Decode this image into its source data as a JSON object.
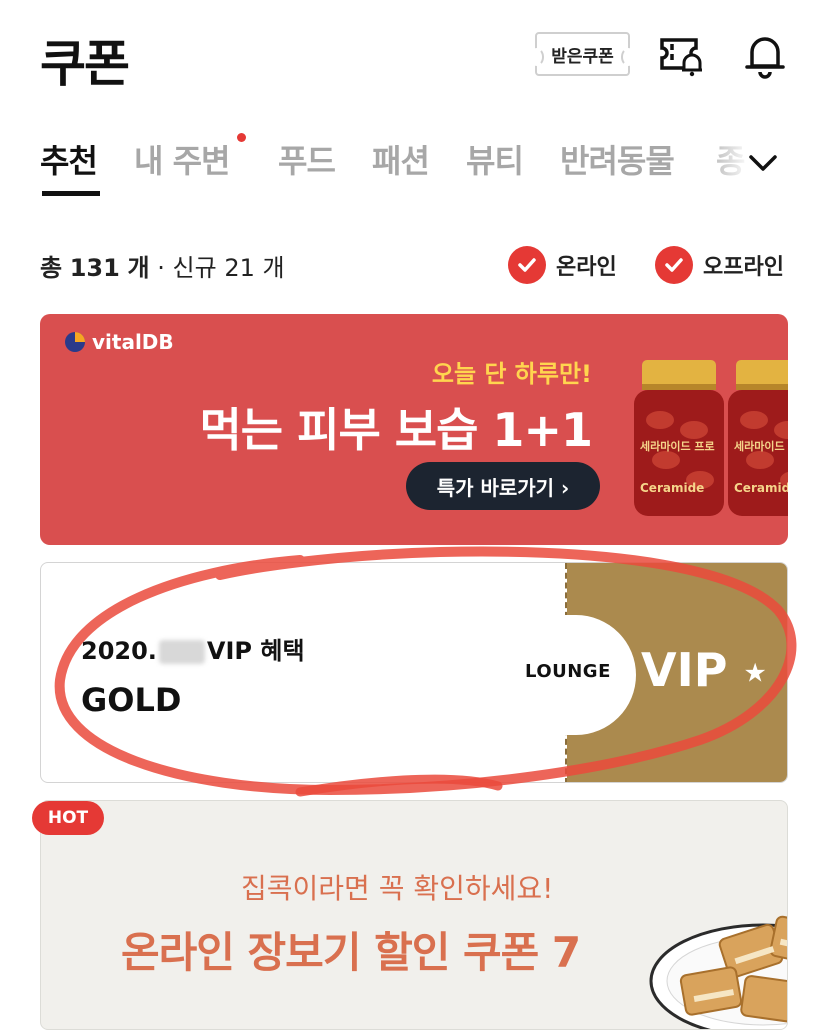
{
  "header": {
    "title": "쿠폰",
    "received_button": "받은쿠폰",
    "icons": [
      "ticket-bell-icon",
      "bell-icon"
    ]
  },
  "tabs": [
    {
      "label": "추천",
      "active": true
    },
    {
      "label": "내 주변",
      "has_dot": true
    },
    {
      "label": "푸드"
    },
    {
      "label": "패션"
    },
    {
      "label": "뷰티"
    },
    {
      "label": "반려동물"
    },
    {
      "label": "종"
    }
  ],
  "summary": {
    "total_prefix": "총",
    "total_count": "131",
    "total_unit": "개",
    "separator": "·",
    "new_prefix": "신규",
    "new_count": "21",
    "new_unit": "개"
  },
  "filters": [
    {
      "label": "온라인",
      "checked": true
    },
    {
      "label": "오프라인",
      "checked": true
    }
  ],
  "banner_promo": {
    "brand": "vitalDB",
    "headline_small": "오늘 단 하루만!",
    "headline_big": "먹는 피부 보습 1+1",
    "button": "특가 바로가기 ›",
    "product_label": "세라마이드 프로",
    "product_sub": "Ceramide",
    "color": "#d94f4f"
  },
  "vip_coupon": {
    "date_prefix": "2020.",
    "date_suffix": "VIP 혜택",
    "tier": "GOLD",
    "lounge": "LOUNGE",
    "badge": "VIP",
    "star": "★",
    "gold_color": "#ab8a4e"
  },
  "hot_banner": {
    "badge": "HOT",
    "subtitle": "집콕이라면 꼭 확인하세요!",
    "title": "온라인 장보기 할인 쿠폰 7",
    "accent": "#d9704f"
  }
}
